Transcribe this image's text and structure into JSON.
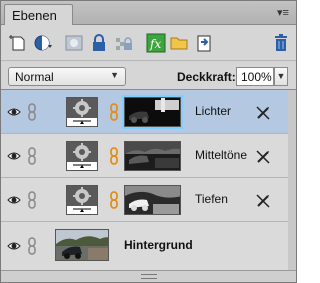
{
  "panel": {
    "tab_label": "Ebenen",
    "menu_glyph": "▾≡"
  },
  "toolbar": {
    "icons": [
      "new-layer-icon",
      "new-fill-adjustment-layer-icon",
      "add-mask-icon",
      "lock-all-icon",
      "lock-transparency-icon",
      "fx-styles-icon",
      "new-group-icon",
      "link-layer-icon",
      "delete-layer-icon"
    ],
    "fx_label": "fx"
  },
  "options": {
    "blend_mode": "Normal",
    "opacity_label": "Deckkraft:",
    "opacity_value": "100%"
  },
  "colors": {
    "selected_row": "#b4c8e2",
    "accent_fx": "#2e8b2e",
    "delete_icon": "#2b5fa8",
    "link_orange": "#e0901a"
  },
  "layers": [
    {
      "name": "Lichter",
      "type": "adjustment",
      "selected": true,
      "mask": "Lichter"
    },
    {
      "name": "Mitteltöne",
      "type": "adjustment",
      "selected": false,
      "mask": "Mitteltöne"
    },
    {
      "name": "Tiefen",
      "type": "adjustment",
      "selected": false,
      "mask": "Tiefen"
    },
    {
      "name": "Hintergrund",
      "type": "background",
      "selected": false
    }
  ]
}
